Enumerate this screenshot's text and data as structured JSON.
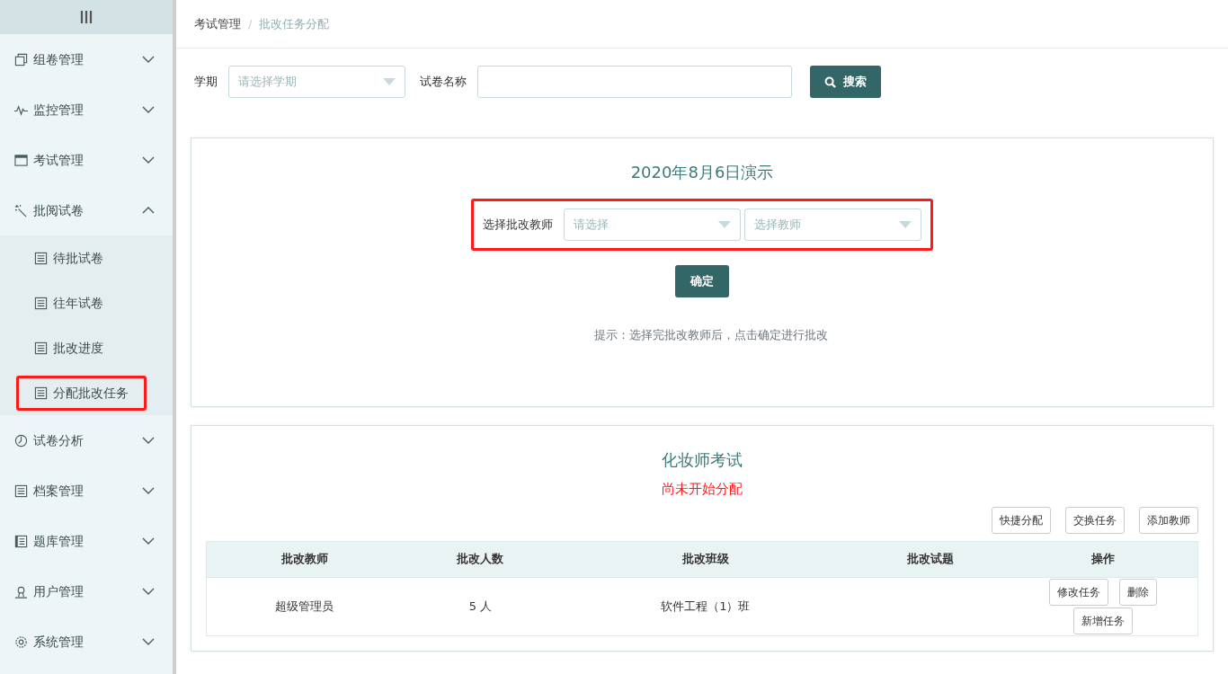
{
  "sidebar": {
    "items": [
      {
        "label": "组卷管理",
        "expanded": false
      },
      {
        "label": "监控管理",
        "expanded": false
      },
      {
        "label": "考试管理",
        "expanded": false
      },
      {
        "label": "批阅试卷",
        "expanded": true,
        "children": [
          {
            "label": "待批试卷",
            "highlighted": false
          },
          {
            "label": "往年试卷",
            "highlighted": false
          },
          {
            "label": "批改进度",
            "highlighted": false
          },
          {
            "label": "分配批改任务",
            "highlighted": true
          }
        ]
      },
      {
        "label": "试卷分析",
        "expanded": false
      },
      {
        "label": "档案管理",
        "expanded": false
      },
      {
        "label": "题库管理",
        "expanded": false
      },
      {
        "label": "用户管理",
        "expanded": false
      },
      {
        "label": "系统管理",
        "expanded": false
      }
    ]
  },
  "breadcrumb": {
    "separator": "/",
    "items": [
      {
        "label": "考试管理",
        "active": false
      },
      {
        "label": "批改任务分配",
        "active": true
      }
    ]
  },
  "filters": {
    "term": {
      "label": "学期",
      "placeholder": "请选择学期"
    },
    "paper_name": {
      "label": "试卷名称"
    },
    "search_button": "搜索"
  },
  "assign_card": {
    "title": "2020年8月6日演示",
    "teacher_select": {
      "label": "选择批改教师",
      "highlighted": true,
      "selects": [
        {
          "placeholder": "请选择"
        },
        {
          "placeholder": "选择教师"
        }
      ]
    },
    "confirm_button": "确定",
    "hint": "提示：选择完批改教师后，点击确定进行批改"
  },
  "task_card": {
    "title": "化妆师考试",
    "status": "尚未开始分配",
    "actions": [
      "快捷分配",
      "交换任务",
      "添加教师"
    ],
    "table": {
      "columns": [
        "批改教师",
        "批改人数",
        "批改班级",
        "批改试题",
        "操作"
      ],
      "rows": [
        {
          "teacher": "超级管理员",
          "count": "5 人",
          "class": "软件工程（1）班",
          "actions": [
            "修改任务",
            "删除",
            "新增任务"
          ]
        }
      ]
    }
  }
}
